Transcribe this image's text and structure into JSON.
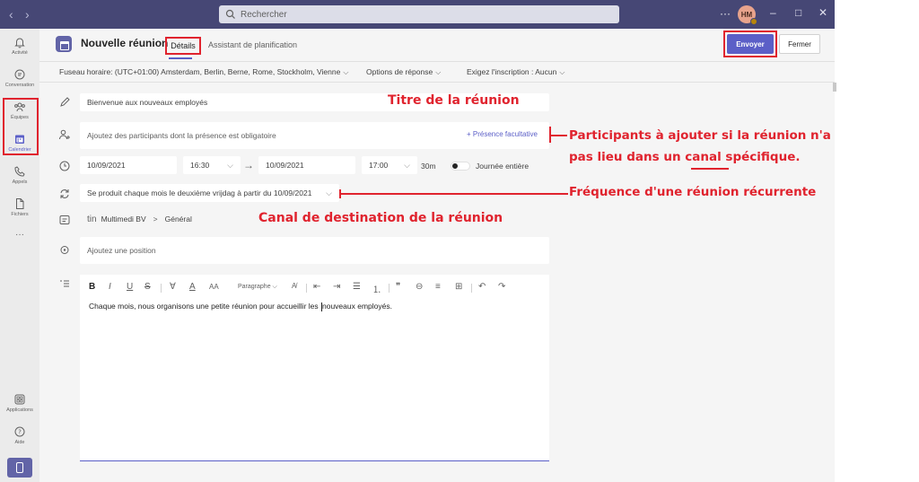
{
  "titlebar": {
    "search_placeholder": "Rechercher",
    "more_label": "···",
    "avatar_initials": "HM",
    "minimize": "–",
    "maximize": "□",
    "close": "✕"
  },
  "rail": {
    "items": [
      {
        "label": "Activité",
        "icon": "bell-icon"
      },
      {
        "label": "Conversation",
        "icon": "chat-icon"
      },
      {
        "label": "Équipes",
        "icon": "teams-icon"
      },
      {
        "label": "Calendrier",
        "icon": "calendar-icon",
        "active": true
      },
      {
        "label": "Appels",
        "icon": "phone-icon"
      },
      {
        "label": "Fichiers",
        "icon": "file-icon"
      },
      {
        "label": "···",
        "icon": "more-icon"
      },
      {
        "label": "Applications",
        "icon": "apps-icon"
      },
      {
        "label": "Aide",
        "icon": "help-icon"
      }
    ]
  },
  "header": {
    "title": "Nouvelle réunion",
    "tab_details": "Détails",
    "tab_assistant": "Assistant de planification",
    "send_label": "Envoyer",
    "close_label": "Fermer"
  },
  "options": {
    "timezone": "Fuseau horaire: (UTC+01:00) Amsterdam, Berlin, Berne, Rome, Stockholm, Vienne",
    "response": "Options de réponse",
    "registration": "Exigez l'inscription : Aucun"
  },
  "form": {
    "title_value": "Bienvenue aux nouveaux employés",
    "participants_placeholder": "Ajoutez des participants dont la présence est obligatoire",
    "optional_link": "+ Présence facultative",
    "start_date": "10/09/2021",
    "start_time": "16:30",
    "end_date": "10/09/2021",
    "end_time": "17:00",
    "duration": "30m",
    "all_day_label": "Journée entière",
    "recurrence": "Se produit chaque mois le deuxième vrijdag à partir du 10/09/2021",
    "channel_team": "Multimedi BV",
    "channel_sep": ">",
    "channel_name": "Général",
    "location_placeholder": "Ajoutez une position",
    "editor_paragraph": "Paragraphe",
    "body_before_caret": "Chaque mois, nous organisons une petite réunion pour accueillir les ",
    "body_after_caret": "nouveaux employés."
  },
  "annotations": {
    "title": "Titre de la réunion",
    "participants_line1": "Participants à ajouter si la réunion n'a",
    "participants_line2": "pas lieu dans un canal spécifique.",
    "recurrence": "Fréquence d'une réunion récurrente",
    "channel": "Canal de destination de la réunion"
  },
  "colors": {
    "titlebar": "#464775",
    "accent": "#5b5fc7",
    "annotation": "#e0232e"
  }
}
